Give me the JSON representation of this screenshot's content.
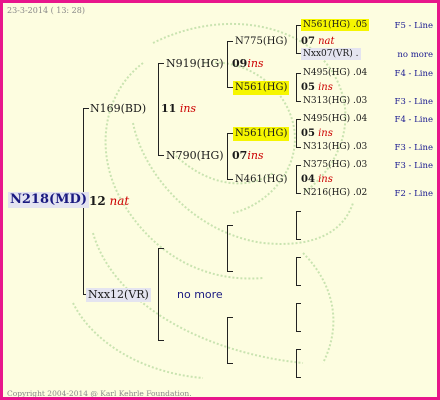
{
  "header": {
    "date": "23-3-2014 ( 13: 28)"
  },
  "root": {
    "name": "N218(MD)",
    "num": "12",
    "flag": "nat"
  },
  "gen1": {
    "dam": {
      "name": "N169(BD)",
      "num": "11",
      "flag": "ins"
    },
    "sire": {
      "name": "Nxx12(VR)",
      "nomore": "no more"
    }
  },
  "gen2": {
    "a": {
      "name": "N919(HG)",
      "num": "09",
      "flag": "ins"
    },
    "b": {
      "name": "N790(HG)",
      "num": "07",
      "flag": "ins"
    }
  },
  "gen3": [
    {
      "name": "N775(HG)",
      "num": "07",
      "flag": "nat"
    },
    {
      "name": "N561(HG)",
      "num": "05",
      "flag": "ins"
    },
    {
      "name": "N561(HG)",
      "num": "05",
      "flag": "ins"
    },
    {
      "name": "N461(HG)",
      "num": "04",
      "flag": "ins"
    }
  ],
  "gen4": [
    {
      "name": "N561(HG) .05",
      "line": "F5 - Line"
    },
    {
      "name": "Nxx07(VR) .",
      "line": "no more"
    },
    {
      "name": "N495(HG) .04",
      "line": "F4 - Line"
    },
    {
      "name": "N313(HG) .03",
      "line": "F3 - Line"
    },
    {
      "name": "N495(HG) .04",
      "line": "F4 - Line"
    },
    {
      "name": "N313(HG) .03",
      "line": "F3 - Line"
    },
    {
      "name": "N375(HG) .03",
      "line": "F3 - Line"
    },
    {
      "name": "N216(HG) .02",
      "line": "F2 - Line"
    }
  ],
  "footer": {
    "copyright": "Copyright 2004-2014 @ Karl Kehrle Foundation."
  },
  "colors": {
    "border": "#e8168c",
    "background": "#fdfde0",
    "highlight": "#f6f600",
    "flag": "#cc0000",
    "line_label": "#1a1a90"
  }
}
